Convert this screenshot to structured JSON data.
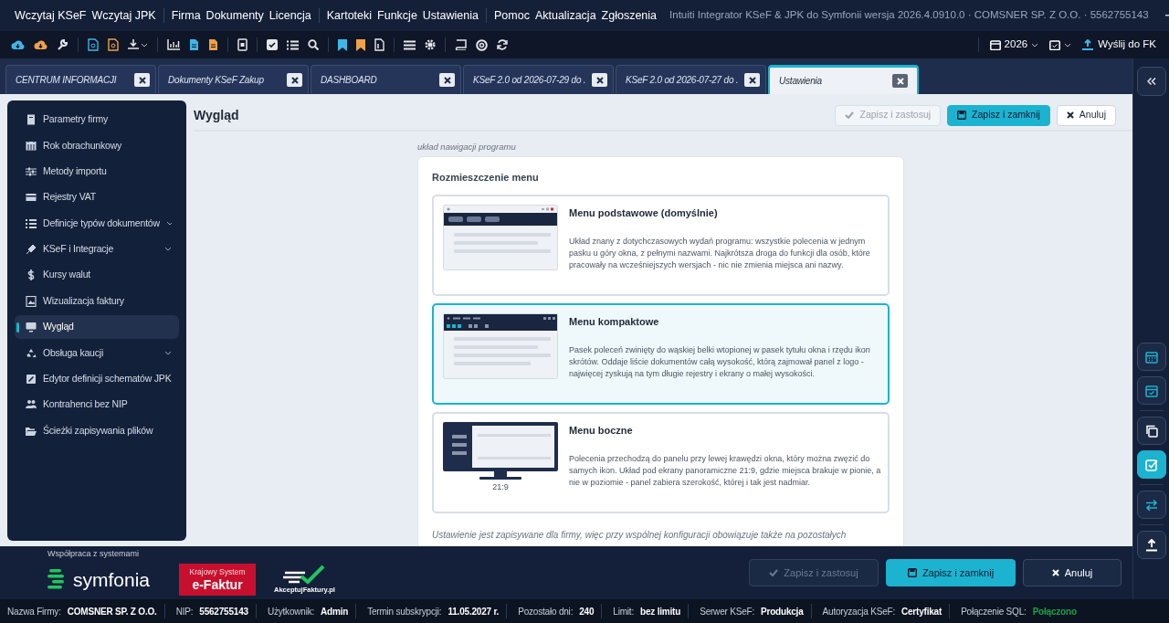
{
  "window": {
    "title": "Intuiti Integrator KSeF & JPK do Symfonii wersja 2026.4.0910.0 · COMSNER SP. Z O.O. · 5562755143"
  },
  "menu": [
    [
      "Wczytaj KSeF",
      "Wczytaj JPK"
    ],
    [
      "Firma",
      "Dokumenty",
      "Licencja"
    ],
    [
      "Kartoteki",
      "Funkcje",
      "Ustawienia"
    ],
    [
      "Pomoc",
      "Aktualizacja",
      "Zgłoszenia"
    ]
  ],
  "toolbar_right": {
    "year": "2026",
    "send": "Wyślij do FK"
  },
  "tabs": [
    {
      "label": "CENTRUM INFORMACJI",
      "selected": false
    },
    {
      "label": "Dokumenty KSeF Zakup",
      "selected": false
    },
    {
      "label": "DASHBOARD",
      "selected": false
    },
    {
      "label": "KSeF 2.0 od 2026-07-29 do .",
      "selected": false
    },
    {
      "label": "KSeF 2.0 od 2026-07-27 do .",
      "selected": false
    },
    {
      "label": "Ustawienia",
      "selected": true
    }
  ],
  "sidebar": {
    "items": [
      {
        "label": "Parametry firmy",
        "expandable": false,
        "selected": false
      },
      {
        "label": "Rok obrachunkowy",
        "expandable": false,
        "selected": false
      },
      {
        "label": "Metody importu",
        "expandable": false,
        "selected": false
      },
      {
        "label": "Rejestry VAT",
        "expandable": false,
        "selected": false
      },
      {
        "label": "Definicje typów dokumentów",
        "expandable": true,
        "selected": false
      },
      {
        "label": "KSeF i Integracje",
        "expandable": true,
        "selected": false
      },
      {
        "label": "Kursy walut",
        "expandable": false,
        "selected": false
      },
      {
        "label": "Wizualizacja faktury",
        "expandable": false,
        "selected": false
      },
      {
        "label": "Wygląd",
        "expandable": false,
        "selected": true
      },
      {
        "label": "Obsługa kaucji",
        "expandable": true,
        "selected": false
      },
      {
        "label": "Edytor definicji schematów JPK",
        "expandable": false,
        "selected": false
      },
      {
        "label": "Kontrahenci bez NIP",
        "expandable": false,
        "selected": false
      },
      {
        "label": "Ścieżki zapisywania plików",
        "expandable": false,
        "selected": false
      }
    ]
  },
  "page": {
    "title": "Wygląd",
    "buttons": [
      {
        "label": "Zapisz i zastosuj",
        "kind": "apply",
        "disabled": true
      },
      {
        "label": "Zapisz i zamknij",
        "kind": "save",
        "disabled": false
      },
      {
        "label": "Anuluj",
        "kind": "cancel",
        "disabled": false
      }
    ],
    "section_caption": "układ nawigacji programu",
    "group_title": "Rozmieszczenie menu",
    "options": [
      {
        "kind": "basic",
        "title": "Menu podstawowe (domyślnie)",
        "description": "Układ znany z dotychczasowych wydań programu: wszystkie polecenia w jednym pasku u góry okna, z pełnymi nazwami. Najkrótsza droga do funkcji dla osób, które pracowały na wcześniejszych wersjach - nic nie zmienia miejsca ani nazwy.",
        "selected": false
      },
      {
        "kind": "compact",
        "title": "Menu kompaktowe",
        "description": "Pasek poleceń zwinięty do wąskiej belki wtopionej w pasek tytułu okna i rzędu ikon skrótów. Oddaje liście dokumentów całą wysokość, którą zajmował panel z logo - najwięcej zyskują na tym długie rejestry i ekrany o małej wysokości.",
        "selected": true
      },
      {
        "kind": "side",
        "title": "Menu boczne",
        "thumb_caption": "21:9",
        "description": "Polecenia przechodzą do panelu przy lewej krawędzi okna, który można zwęzić do samych ikon. Układ pod ekrany panoramiczne 21:9, gdzie miejsca brakuje w pionie, a nie w poziomie - panel zabiera szerokość, której i tak jest nadmiar.",
        "selected": false
      }
    ],
    "note": "Ustawienie jest zapisywane dla firmy, więc przy wspólnej konfiguracji obowiązuje także na pozostałych"
  },
  "rail": [
    {
      "selected": false
    },
    {
      "selected": false
    },
    {
      "selected": false
    },
    {
      "selected": true
    },
    {
      "selected": false
    },
    {
      "selected": false
    }
  ],
  "footer": {
    "partners_caption": "Współpraca z systemami",
    "symfonia": "symfonia",
    "ksef_small": "Krajowy System",
    "ksef_big": "e-Faktur",
    "akceptuj": "AkceptujFaktury.pl",
    "buttons": [
      {
        "label": "Zapisz i zastosuj",
        "kind": "apply",
        "disabled": true
      },
      {
        "label": "Zapisz i zamknij",
        "kind": "save",
        "disabled": false
      },
      {
        "label": "Anuluj",
        "kind": "cancel",
        "disabled": false
      }
    ]
  },
  "status_bar": [
    {
      "label": "Nazwa Firmy:",
      "value": "COMSNER SP. Z O.O.",
      "kind": "plain"
    },
    {
      "label": "NIP:",
      "value": "5562755143",
      "kind": "plain"
    },
    {
      "label": "Użytkownik:",
      "value": "Admin",
      "kind": "plain"
    },
    {
      "label": "Termin subskrypcji:",
      "value": "11.05.2027 r.",
      "kind": "plain"
    },
    {
      "label": "Pozostało dni:",
      "value": "240",
      "kind": "plain"
    },
    {
      "label": "Limit:",
      "value": "bez limitu",
      "kind": "plain"
    },
    {
      "label": "Serwer KSeF:",
      "value": "Produkcja",
      "kind": "plain"
    },
    {
      "label": "Autoryzacja KSeF:",
      "value": "Certyfikat",
      "kind": "plain"
    },
    {
      "label": "Połączenie SQL:",
      "value": "Połączono",
      "kind": "ok"
    }
  ]
}
